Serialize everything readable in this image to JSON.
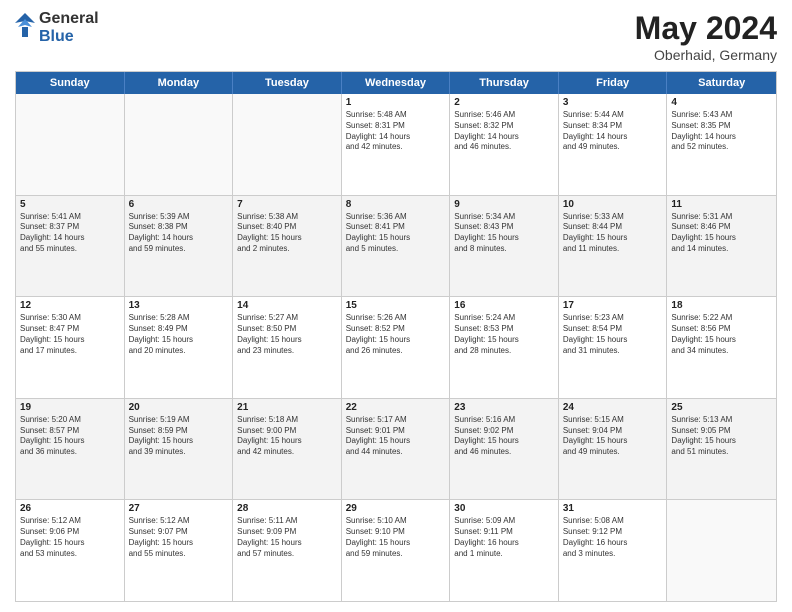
{
  "logo": {
    "general": "General",
    "blue": "Blue"
  },
  "title": {
    "month": "May 2024",
    "location": "Oberhaid, Germany"
  },
  "header_days": [
    "Sunday",
    "Monday",
    "Tuesday",
    "Wednesday",
    "Thursday",
    "Friday",
    "Saturday"
  ],
  "weeks": [
    [
      {
        "day": "",
        "text": ""
      },
      {
        "day": "",
        "text": ""
      },
      {
        "day": "",
        "text": ""
      },
      {
        "day": "1",
        "text": "Sunrise: 5:48 AM\nSunset: 8:31 PM\nDaylight: 14 hours\nand 42 minutes."
      },
      {
        "day": "2",
        "text": "Sunrise: 5:46 AM\nSunset: 8:32 PM\nDaylight: 14 hours\nand 46 minutes."
      },
      {
        "day": "3",
        "text": "Sunrise: 5:44 AM\nSunset: 8:34 PM\nDaylight: 14 hours\nand 49 minutes."
      },
      {
        "day": "4",
        "text": "Sunrise: 5:43 AM\nSunset: 8:35 PM\nDaylight: 14 hours\nand 52 minutes."
      }
    ],
    [
      {
        "day": "5",
        "text": "Sunrise: 5:41 AM\nSunset: 8:37 PM\nDaylight: 14 hours\nand 55 minutes."
      },
      {
        "day": "6",
        "text": "Sunrise: 5:39 AM\nSunset: 8:38 PM\nDaylight: 14 hours\nand 59 minutes."
      },
      {
        "day": "7",
        "text": "Sunrise: 5:38 AM\nSunset: 8:40 PM\nDaylight: 15 hours\nand 2 minutes."
      },
      {
        "day": "8",
        "text": "Sunrise: 5:36 AM\nSunset: 8:41 PM\nDaylight: 15 hours\nand 5 minutes."
      },
      {
        "day": "9",
        "text": "Sunrise: 5:34 AM\nSunset: 8:43 PM\nDaylight: 15 hours\nand 8 minutes."
      },
      {
        "day": "10",
        "text": "Sunrise: 5:33 AM\nSunset: 8:44 PM\nDaylight: 15 hours\nand 11 minutes."
      },
      {
        "day": "11",
        "text": "Sunrise: 5:31 AM\nSunset: 8:46 PM\nDaylight: 15 hours\nand 14 minutes."
      }
    ],
    [
      {
        "day": "12",
        "text": "Sunrise: 5:30 AM\nSunset: 8:47 PM\nDaylight: 15 hours\nand 17 minutes."
      },
      {
        "day": "13",
        "text": "Sunrise: 5:28 AM\nSunset: 8:49 PM\nDaylight: 15 hours\nand 20 minutes."
      },
      {
        "day": "14",
        "text": "Sunrise: 5:27 AM\nSunset: 8:50 PM\nDaylight: 15 hours\nand 23 minutes."
      },
      {
        "day": "15",
        "text": "Sunrise: 5:26 AM\nSunset: 8:52 PM\nDaylight: 15 hours\nand 26 minutes."
      },
      {
        "day": "16",
        "text": "Sunrise: 5:24 AM\nSunset: 8:53 PM\nDaylight: 15 hours\nand 28 minutes."
      },
      {
        "day": "17",
        "text": "Sunrise: 5:23 AM\nSunset: 8:54 PM\nDaylight: 15 hours\nand 31 minutes."
      },
      {
        "day": "18",
        "text": "Sunrise: 5:22 AM\nSunset: 8:56 PM\nDaylight: 15 hours\nand 34 minutes."
      }
    ],
    [
      {
        "day": "19",
        "text": "Sunrise: 5:20 AM\nSunset: 8:57 PM\nDaylight: 15 hours\nand 36 minutes."
      },
      {
        "day": "20",
        "text": "Sunrise: 5:19 AM\nSunset: 8:59 PM\nDaylight: 15 hours\nand 39 minutes."
      },
      {
        "day": "21",
        "text": "Sunrise: 5:18 AM\nSunset: 9:00 PM\nDaylight: 15 hours\nand 42 minutes."
      },
      {
        "day": "22",
        "text": "Sunrise: 5:17 AM\nSunset: 9:01 PM\nDaylight: 15 hours\nand 44 minutes."
      },
      {
        "day": "23",
        "text": "Sunrise: 5:16 AM\nSunset: 9:02 PM\nDaylight: 15 hours\nand 46 minutes."
      },
      {
        "day": "24",
        "text": "Sunrise: 5:15 AM\nSunset: 9:04 PM\nDaylight: 15 hours\nand 49 minutes."
      },
      {
        "day": "25",
        "text": "Sunrise: 5:13 AM\nSunset: 9:05 PM\nDaylight: 15 hours\nand 51 minutes."
      }
    ],
    [
      {
        "day": "26",
        "text": "Sunrise: 5:12 AM\nSunset: 9:06 PM\nDaylight: 15 hours\nand 53 minutes."
      },
      {
        "day": "27",
        "text": "Sunrise: 5:12 AM\nSunset: 9:07 PM\nDaylight: 15 hours\nand 55 minutes."
      },
      {
        "day": "28",
        "text": "Sunrise: 5:11 AM\nSunset: 9:09 PM\nDaylight: 15 hours\nand 57 minutes."
      },
      {
        "day": "29",
        "text": "Sunrise: 5:10 AM\nSunset: 9:10 PM\nDaylight: 15 hours\nand 59 minutes."
      },
      {
        "day": "30",
        "text": "Sunrise: 5:09 AM\nSunset: 9:11 PM\nDaylight: 16 hours\nand 1 minute."
      },
      {
        "day": "31",
        "text": "Sunrise: 5:08 AM\nSunset: 9:12 PM\nDaylight: 16 hours\nand 3 minutes."
      },
      {
        "day": "",
        "text": ""
      }
    ]
  ]
}
